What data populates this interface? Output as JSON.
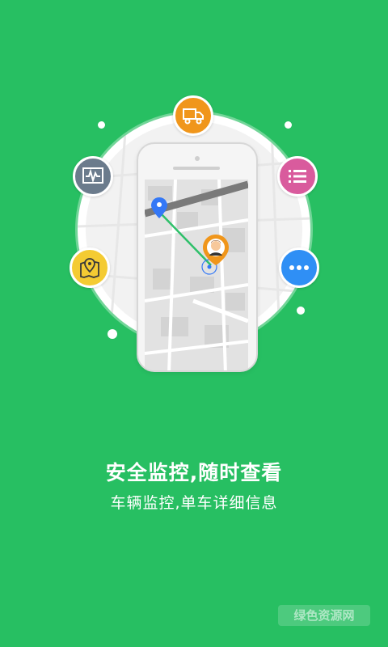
{
  "theme": {
    "background": "#27bf62",
    "text": "#ffffff"
  },
  "illustration": {
    "badges": [
      {
        "name": "truck-icon",
        "color": "#f0961b"
      },
      {
        "name": "monitor-chart-icon",
        "color": "#6b7b8c"
      },
      {
        "name": "list-icon",
        "color": "#d95b9d"
      },
      {
        "name": "map-pin-icon",
        "color": "#f4cb33"
      },
      {
        "name": "more-icon",
        "color": "#2f8ff5"
      }
    ],
    "route": {
      "start_color": "#3478f6",
      "line_color": "#2fc06a",
      "driver_pin_color": "#f0961b"
    }
  },
  "content": {
    "headline": "安全监控,随时查看",
    "subline": "车辆监控,单车详细信息"
  },
  "watermark": {
    "text": "绿色资源网"
  }
}
